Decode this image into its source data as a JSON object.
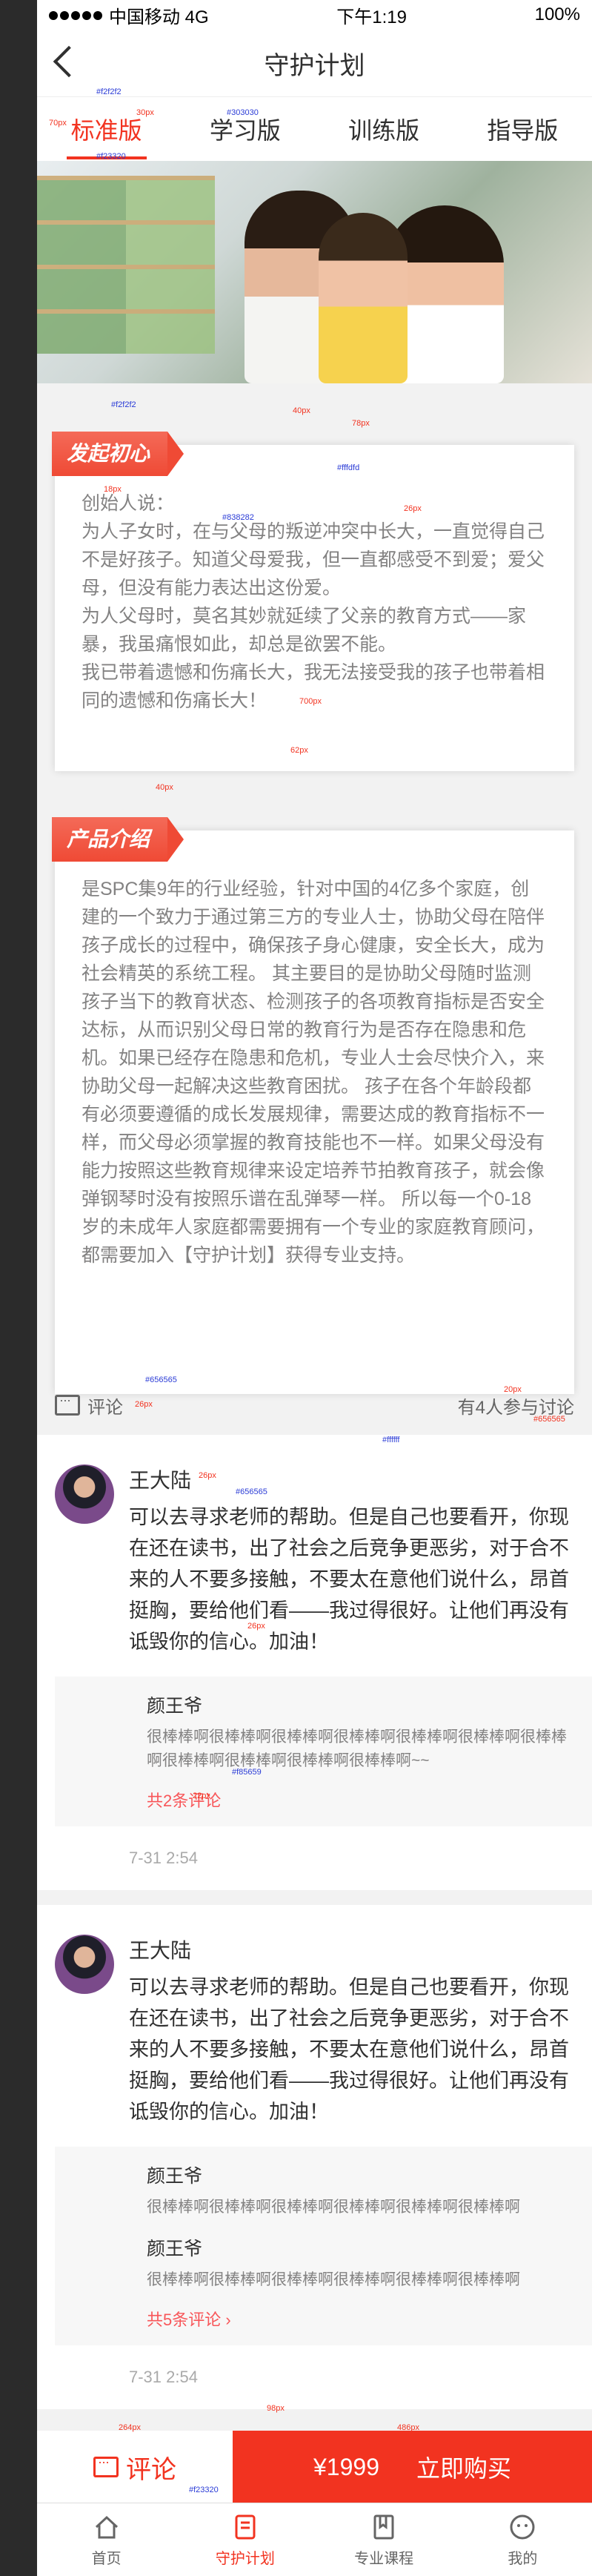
{
  "status": {
    "carrier": "中国移动 4G",
    "time": "下午1:19",
    "battery": "100%"
  },
  "nav": {
    "title": "守护计划"
  },
  "tabs": [
    {
      "label": "标准版"
    },
    {
      "label": "学习版"
    },
    {
      "label": "训练版"
    },
    {
      "label": "指导版"
    }
  ],
  "section1": {
    "ribbon": "发起初心",
    "paragraphs": [
      "创始人说：",
      "为人子女时，在与父母的叛逆冲突中长大，一直觉得自己不是好孩子。知道父母爱我，但一直都感受不到爱；爱父母，但没有能力表达出这份爱。",
      "为人父母时，莫名其妙就延续了父亲的教育方式——家暴，我虽痛恨如此，却总是欲罢不能。",
      "我已带着遗憾和伤痛长大，我无法接受我的孩子也带着相同的遗憾和伤痛长大！"
    ]
  },
  "section2": {
    "ribbon": "产品介绍",
    "text": "是SPC集9年的行业经验，针对中国的4亿多个家庭，创建的一个致力于通过第三方的专业人士，协助父母在陪伴孩子成长的过程中，确保孩子身心健康，安全长大，成为社会精英的系统工程。 其主要目的是协助父母随时监测孩子当下的教育状态、检测孩子的各项教育指标是否安全达标，从而识别父母日常的教育行为是否存在隐患和危机。如果已经存在隐患和危机，专业人士会尽快介入，来协助父母一起解决这些教育困扰。 孩子在各个年龄段都有必须要遵循的成长发展规律，需要达成的教育指标不一样，而父母必须掌握的教育技能也不一样。如果父母没有能力按照这些教育规律来设定培养节拍教育孩子，就会像弹钢琴时没有按照乐谱在乱弹琴一样。 所以每一个0-18岁的未成年人家庭都需要拥有一个专业的家庭教育顾问，都需要加入【守护计划】获得专业支持。"
  },
  "comments_header": {
    "label": "评论",
    "count": "有4人参与讨论"
  },
  "comments": [
    {
      "name": "王大陆",
      "text": "可以去寻求老师的帮助。但是自己也要看开，你现在还在读书，出了社会之后竞争更恶劣，对于合不来的人不要多接触，不要太在意他们说什么，昂首挺胸，要给他们看——我过得很好。让他们再没有诋毁你的信心。加油！",
      "replies": [
        {
          "name": "颜王爷",
          "text": "很棒棒啊很棒棒啊很棒棒啊很棒棒啊很棒棒啊很棒棒啊很棒棒啊很棒棒啊很棒棒啊很棒棒啊很棒棒啊~~"
        }
      ],
      "more": "共2条评论",
      "time": "7-31   2:54"
    },
    {
      "name": "王大陆",
      "text": "可以去寻求老师的帮助。但是自己也要看开，你现在还在读书，出了社会之后竞争更恶劣，对于合不来的人不要多接触，不要太在意他们说什么，昂首挺胸，要给他们看——我过得很好。让他们再没有诋毁你的信心。加油！",
      "replies": [
        {
          "name": "颜王爷",
          "text": "很棒棒啊很棒棒啊很棒棒啊很棒棒啊很棒棒啊很棒棒啊"
        },
        {
          "name": "颜王爷",
          "text": "很棒棒啊很棒棒啊很棒棒啊很棒棒啊很棒棒啊很棒棒啊"
        }
      ],
      "more": "共5条评论",
      "time": "7-31   2:54"
    }
  ],
  "buybar": {
    "comment": "评论",
    "price": "¥1999",
    "buy": "立即购买"
  },
  "tabbar": [
    {
      "label": "首页"
    },
    {
      "label": "守护计划"
    },
    {
      "label": "专业课程"
    },
    {
      "label": "我的"
    }
  ],
  "annotations": [
    "#f2f2f2",
    "30px",
    "#303030",
    "70px",
    "#f23320",
    "#f2f2f2",
    "40px",
    "78px",
    "#fffdfd",
    "18px",
    "#838282",
    "26px",
    "700px",
    "62px",
    "40px",
    "#656565",
    "26px",
    "20px",
    "#656565",
    "#ffffff",
    "26px",
    "#656565",
    "26px",
    "#f85659",
    "22px",
    "98px",
    "264px",
    "486px",
    "#f23320"
  ],
  "colors": {
    "accent": "#f23320",
    "text": "#303030",
    "gray": "#838282",
    "pink": "#f85659"
  }
}
